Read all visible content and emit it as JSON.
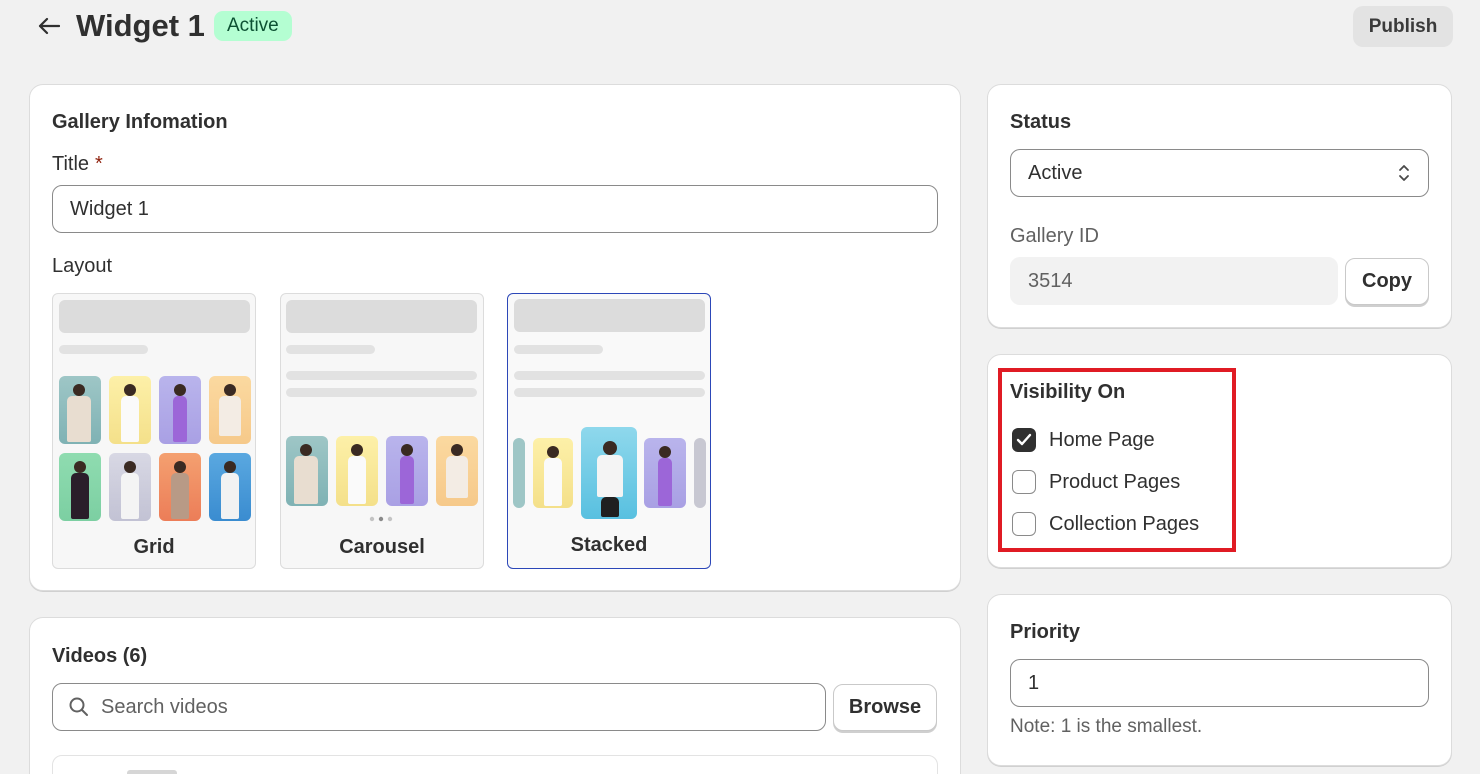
{
  "header": {
    "title": "Widget 1",
    "status_badge": "Active",
    "publish_label": "Publish"
  },
  "gallery_info": {
    "heading": "Gallery Infomation",
    "title_label": "Title",
    "required_mark": "*",
    "title_value": "Widget 1",
    "layout_label": "Layout",
    "layouts": [
      {
        "label": "Grid",
        "selected": false
      },
      {
        "label": "Carousel",
        "selected": false
      },
      {
        "label": "Stacked",
        "selected": true
      }
    ]
  },
  "status_card": {
    "heading": "Status",
    "status_value": "Active",
    "gallery_id_label": "Gallery ID",
    "gallery_id_value": "3514",
    "copy_label": "Copy"
  },
  "visibility": {
    "heading": "Visibility On",
    "options": [
      {
        "label": "Home Page",
        "checked": true
      },
      {
        "label": "Product Pages",
        "checked": false
      },
      {
        "label": "Collection Pages",
        "checked": false
      }
    ]
  },
  "priority": {
    "heading": "Priority",
    "value": "1",
    "note": "Note: 1 is the smallest."
  },
  "videos": {
    "heading": "Videos (6)",
    "search_placeholder": "Search videos",
    "browse_label": "Browse"
  },
  "colors": {
    "accent_selected": "#2c47b8",
    "badge_bg": "#b4fed2",
    "highlight": "#e01b24"
  }
}
